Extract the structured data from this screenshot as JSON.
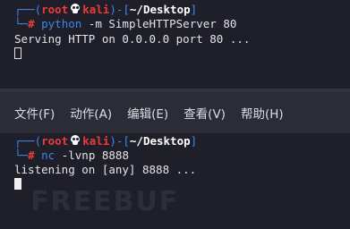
{
  "top_terminal": {
    "prompt": {
      "corner": "┌──(",
      "user": "root",
      "host": "kali",
      "mid": ")-[",
      "path": "~/Desktop",
      "close": "]",
      "second_corner": "└─",
      "hash": "#"
    },
    "command": {
      "program": "python",
      "args": " -m SimpleHTTPServer 80"
    },
    "output": "Serving HTTP on 0.0.0.0 port 80 ..."
  },
  "menubar": {
    "items": [
      "文件(F)",
      "动作(A)",
      "编辑(E)",
      "查看(V)",
      "帮助(H)"
    ]
  },
  "bottom_terminal": {
    "prompt": {
      "corner": "┌──(",
      "user": "root",
      "host": "kali",
      "mid": ")-[",
      "path": "~/Desktop",
      "close": "]",
      "second_corner": "└─",
      "hash": "#"
    },
    "command": {
      "program": "nc",
      "args": " -lvnp 8888"
    },
    "output": "listening on [any] 8888 ..."
  },
  "watermark": "FREEBUF",
  "colors": {
    "background": "#1e1f29",
    "prompt_blue": "#3e86ef",
    "user_red": "#ef3a3a",
    "text": "#e4e4e8",
    "menubar": "#2b2c36"
  },
  "icons": [
    "skull-icon"
  ]
}
